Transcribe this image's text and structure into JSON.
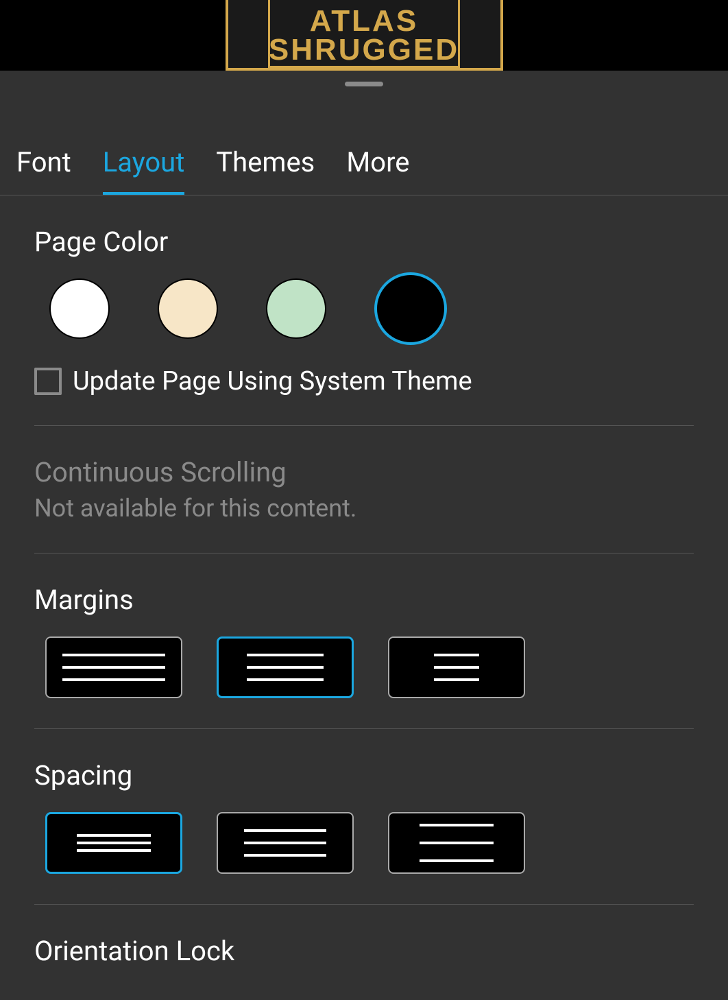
{
  "book": {
    "title_line1": "ATLAS",
    "title_line2": "SHRUGGED"
  },
  "tabs": {
    "font": "Font",
    "layout": "Layout",
    "themes": "Themes",
    "more": "More",
    "active": "layout"
  },
  "page_color": {
    "title": "Page Color",
    "options": [
      {
        "name": "white",
        "hex": "#ffffff",
        "selected": false
      },
      {
        "name": "sepia",
        "hex": "#f7e6c7",
        "selected": false
      },
      {
        "name": "green",
        "hex": "#c0e3c6",
        "selected": false
      },
      {
        "name": "black",
        "hex": "#000000",
        "selected": true
      }
    ],
    "checkbox_label": "Update Page Using System Theme",
    "checkbox_checked": false
  },
  "continuous_scrolling": {
    "title": "Continuous Scrolling",
    "subtext": "Not available for this content."
  },
  "margins": {
    "title": "Margins",
    "selected": "medium"
  },
  "spacing": {
    "title": "Spacing",
    "selected": "tight"
  },
  "orientation_lock": {
    "title": "Orientation Lock"
  },
  "colors": {
    "accent": "#1ba7e0"
  }
}
